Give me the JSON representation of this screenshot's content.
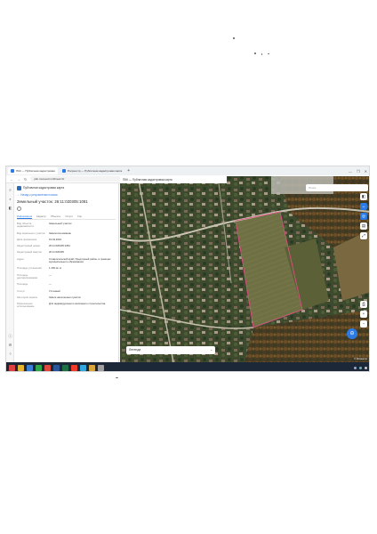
{
  "browser": {
    "tabs": [
      {
        "label": "ПКК — Публичная кадастровая",
        "active": true
      },
      {
        "label": "Росреестр — Публичная кадастровая карта",
        "active": false
      }
    ],
    "new_tab": "+",
    "url": "pkk.rosreestr.ru/#/search/",
    "window_controls": [
      "—",
      "❐",
      "✕"
    ]
  },
  "panel": {
    "brand": "Публичная кадастровая карта",
    "back_link": "← Назад к результатам поиска",
    "title": "Земельный участок: 26:11:020305:1081",
    "tabs": [
      {
        "label": "Информация",
        "active": true
      },
      {
        "label": "Кадастр",
        "active": false
      },
      {
        "label": "Объекты",
        "active": false
      },
      {
        "label": "Услуги",
        "active": false
      },
      {
        "label": "Спр.",
        "active": false
      }
    ],
    "rows": [
      {
        "label": "Вид объекта недвижимости",
        "value": "Земельный участок"
      },
      {
        "label": "Вид земельного участка",
        "value": "Землепользование"
      },
      {
        "label": "Дата присвоения",
        "value": "19.04.2022"
      },
      {
        "label": "Кадастровый номер",
        "value": "26:11:020305:1081"
      },
      {
        "label": "Кадастровый квартал",
        "value": "26:11:020305"
      },
      {
        "label": "Адрес",
        "value": "Ставропольский край, Предгорный район, в границах муниципального образования"
      },
      {
        "label": "Площадь уточненная",
        "value": "1 200 кв. м"
      },
      {
        "label": "Площадь декларированная",
        "value": "—"
      },
      {
        "label": "Площадь",
        "value": "—"
      },
      {
        "label": "Статус",
        "value": "Учтенный"
      },
      {
        "label": "Категория земель",
        "value": "Земли населенных пунктов"
      },
      {
        "label": "Разрешенное использование",
        "value": "Для индивидуального жилищного строительства"
      }
    ]
  },
  "map": {
    "title": "ПКК — Публичная кадастровая карта",
    "search_placeholder": "Поиск",
    "legend_label": "Легенда",
    "legend_chevron": "⌄",
    "attribution": "© Росреестр",
    "fab_icon": "⊖",
    "controls": [
      {
        "name": "layers-button",
        "glyph": "◧",
        "blue": false
      },
      {
        "name": "measure-button",
        "glyph": "↔",
        "blue": true
      },
      {
        "name": "locate-button",
        "glyph": "◎",
        "blue": true
      },
      {
        "name": "basemap-button",
        "glyph": "▤",
        "blue": false
      },
      {
        "name": "fullscreen-button",
        "glyph": "⤢",
        "blue": false
      },
      {
        "name": "print-button",
        "glyph": "⎙",
        "blue": false
      },
      {
        "name": "zoom-in-button",
        "glyph": "+",
        "blue": false
      },
      {
        "name": "zoom-out-button",
        "glyph": "−",
        "blue": false
      }
    ]
  },
  "taskbar": {
    "icons": [
      {
        "name": "start-button",
        "color": "#e04040"
      },
      {
        "name": "explorer-icon",
        "color": "#e8b530"
      },
      {
        "name": "mail-icon",
        "color": "#3c7fd6"
      },
      {
        "name": "browser-icon",
        "color": "#2ea84a"
      },
      {
        "name": "chrome-icon",
        "color": "#e0483b"
      },
      {
        "name": "word-icon",
        "color": "#2b579a"
      },
      {
        "name": "excel-icon",
        "color": "#1e7145"
      },
      {
        "name": "yandex-icon",
        "color": "#f03b2b"
      },
      {
        "name": "edge-icon",
        "color": "#31a7e0"
      },
      {
        "name": "folder-icon",
        "color": "#d8a63d"
      },
      {
        "name": "app-icon",
        "color": "#a0a0a0"
      }
    ],
    "tray_colors": [
      "#9ac",
      "#7ab",
      "#ccc"
    ]
  },
  "colors": {
    "accent": "#2c7be5",
    "taskbar": "#1c2838"
  }
}
